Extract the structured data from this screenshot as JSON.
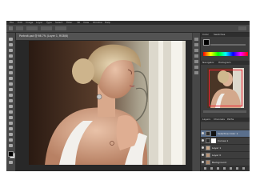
{
  "menubar": {
    "items": [
      "File",
      "Edit",
      "Image",
      "Layer",
      "Type",
      "Select",
      "Filter",
      "3D",
      "View",
      "Window",
      "Help"
    ]
  },
  "document": {
    "tab_title": "Portrait.psd @ 66.7% (Layer 1, RGB/8)"
  },
  "panels": {
    "color_tabs": [
      "Color",
      "Swatches"
    ],
    "navigator_tabs": [
      "Navigator",
      "Histogram"
    ],
    "layers_tabs": [
      "Layers",
      "Channels",
      "Paths"
    ],
    "layers": [
      {
        "name": "Selective Color 1"
      },
      {
        "name": "Curves 1"
      },
      {
        "name": "Layer 1"
      },
      {
        "name": "Layer 0"
      },
      {
        "name": "Background"
      }
    ]
  },
  "colors": {
    "accent_selected_layer": "#5a6f8c",
    "foreground": "#000000",
    "background": "#ffffff"
  }
}
